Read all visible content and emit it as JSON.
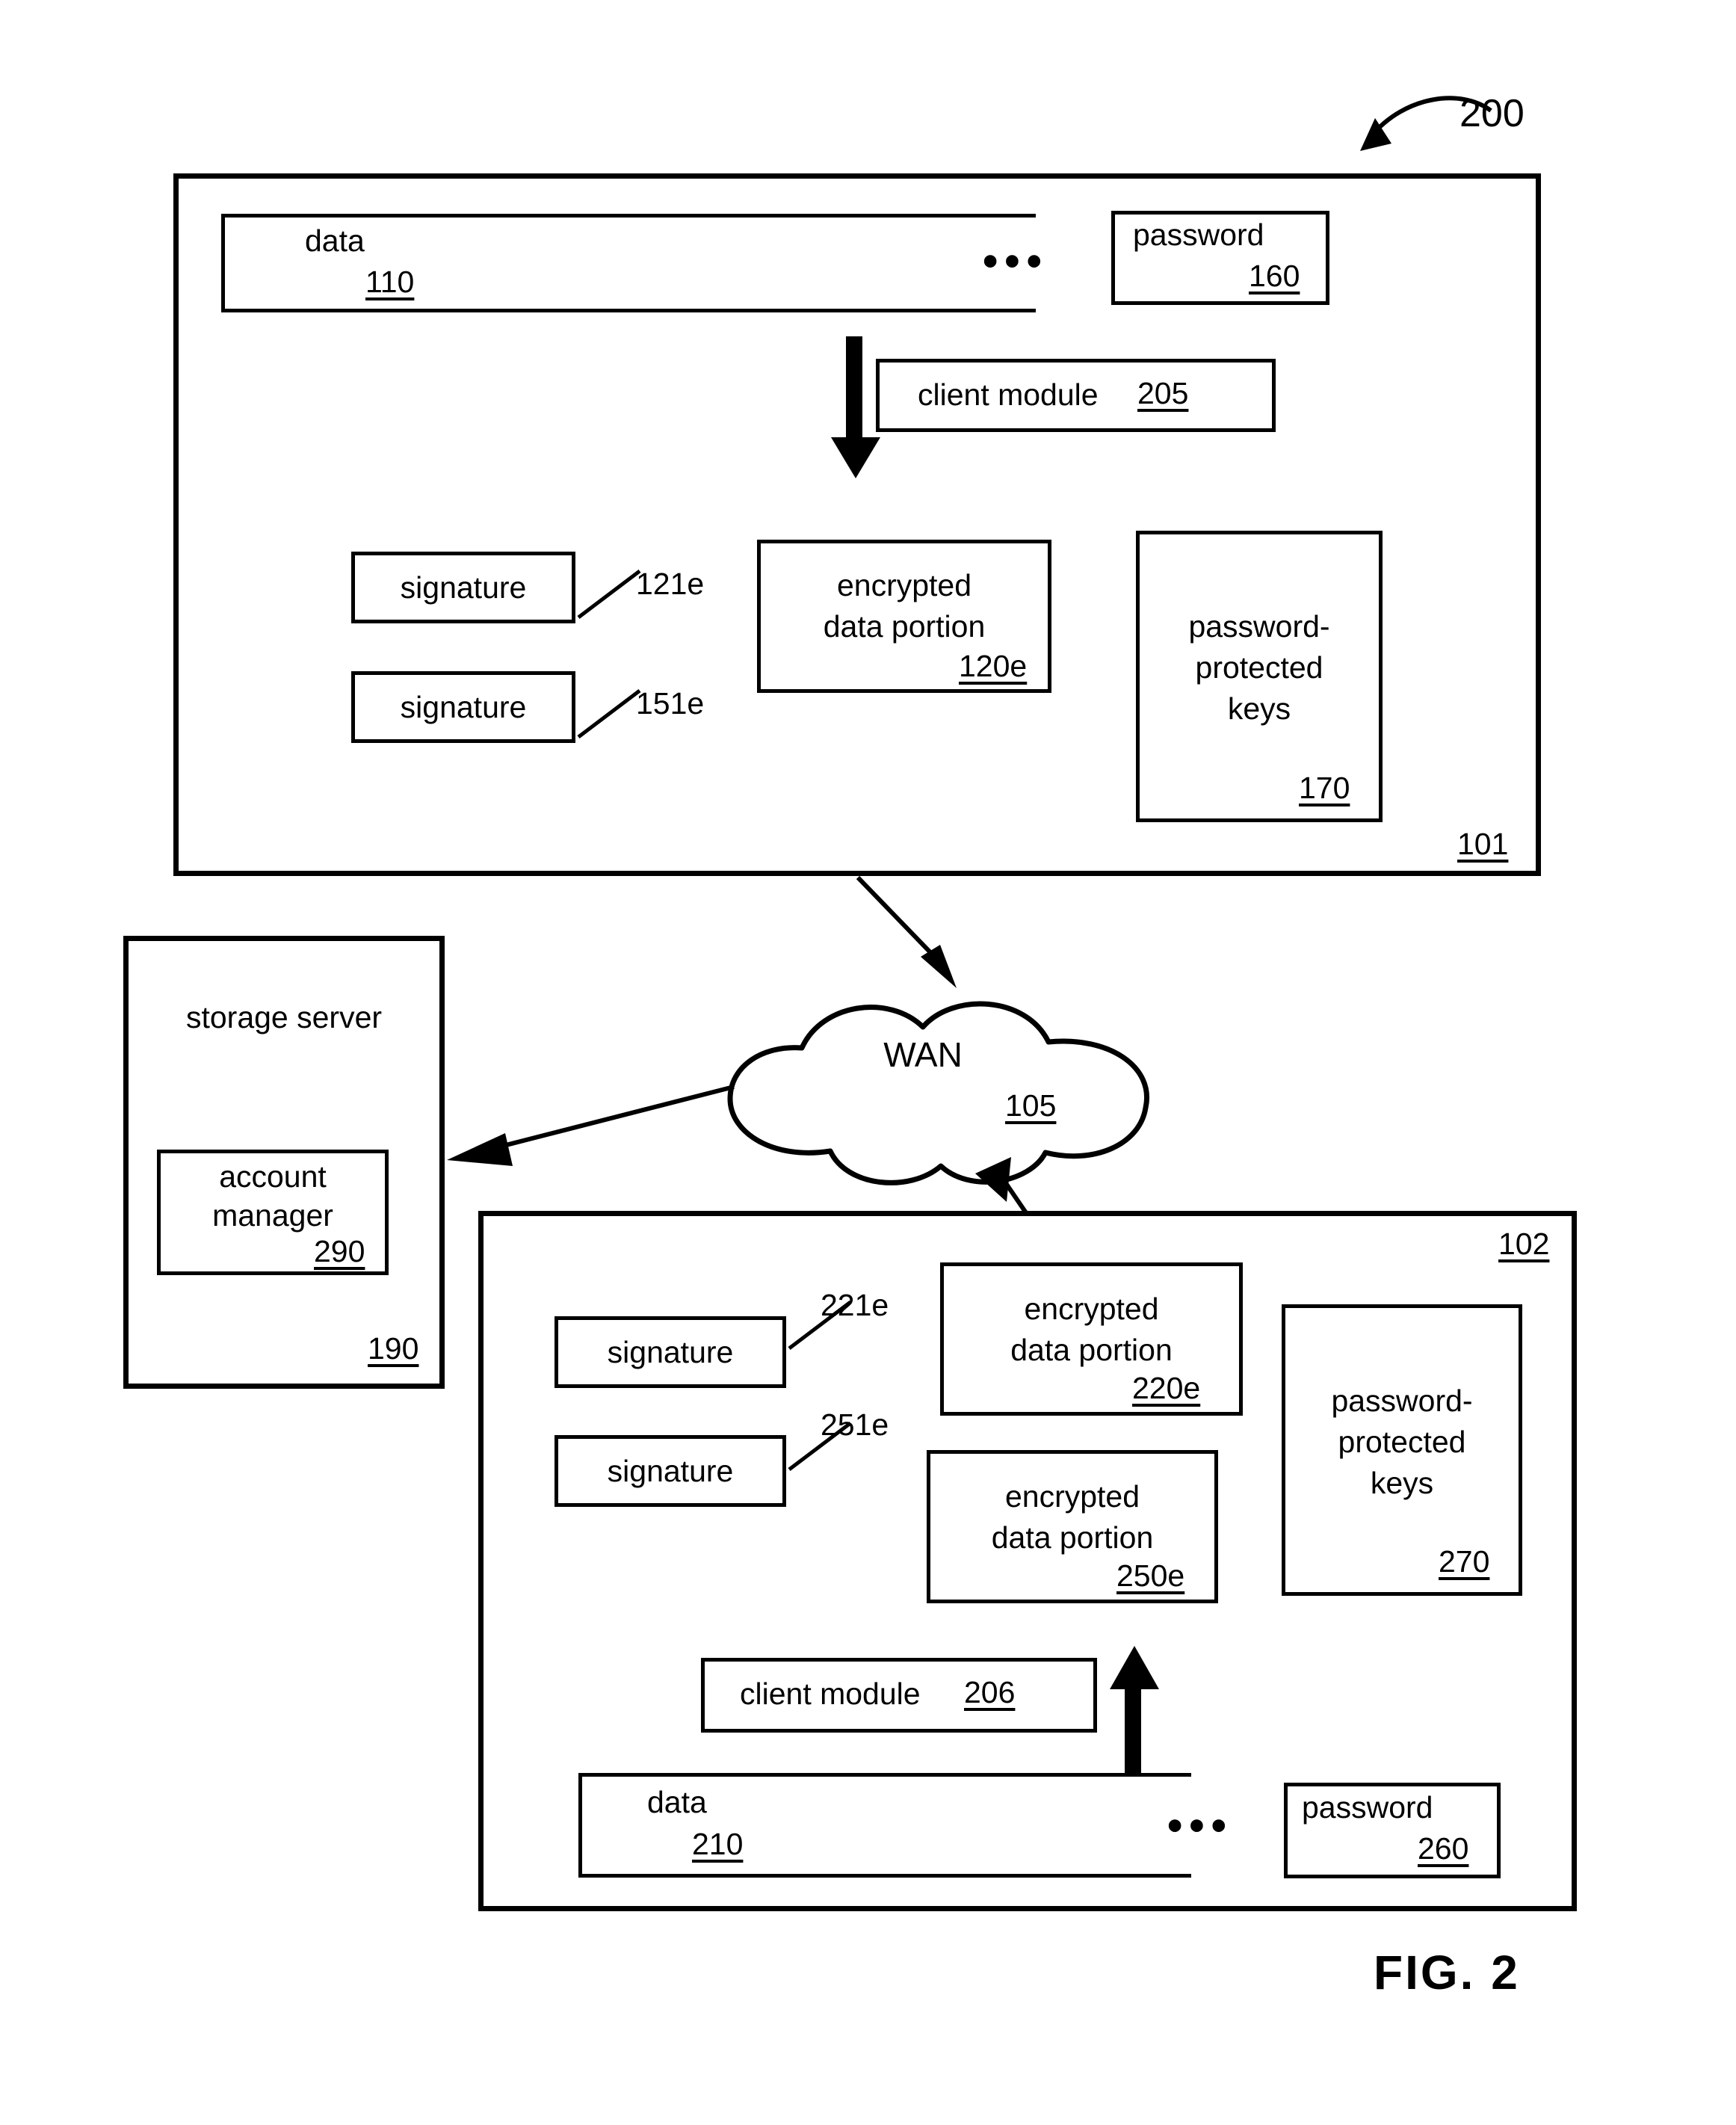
{
  "figure": {
    "caption": "FIG.  2",
    "system_ref": "200"
  },
  "client_101": {
    "ref": "101",
    "data_box": {
      "label": "data",
      "ref": "110"
    },
    "ellipsis": "•••",
    "password_box": {
      "label": "password",
      "ref": "160"
    },
    "client_module": {
      "label": "client module",
      "ref": "205"
    },
    "signature_1": {
      "label": "signature",
      "ref": "121e"
    },
    "signature_2": {
      "label": "signature",
      "ref": "151e"
    },
    "encrypted_data_portion": {
      "line1": "encrypted",
      "line2": "data portion",
      "ref": "120e"
    },
    "password_protected_keys": {
      "line1": "password-",
      "line2": "protected",
      "line3": "keys",
      "ref": "170"
    }
  },
  "network": {
    "label": "WAN",
    "ref": "105"
  },
  "storage_server": {
    "label": "storage server",
    "ref": "190",
    "account_manager": {
      "line1": "account",
      "line2": "manager",
      "ref": "290"
    }
  },
  "client_102": {
    "ref": "102",
    "signature_1": {
      "label": "signature",
      "ref": "221e"
    },
    "signature_2": {
      "label": "signature",
      "ref": "251e"
    },
    "encrypted_data_portion_1": {
      "line1": "encrypted",
      "line2": "data portion",
      "ref": "220e"
    },
    "encrypted_data_portion_2": {
      "line1": "encrypted",
      "line2": "data portion",
      "ref": "250e"
    },
    "password_protected_keys": {
      "line1": "password-",
      "line2": "protected",
      "line3": "keys",
      "ref": "270"
    },
    "client_module": {
      "label": "client module",
      "ref": "206"
    },
    "data_box": {
      "label": "data",
      "ref": "210"
    },
    "ellipsis": "•••",
    "password_box": {
      "label": "password",
      "ref": "260"
    }
  },
  "colors": {
    "ink": "#000000",
    "paper": "#ffffff"
  }
}
